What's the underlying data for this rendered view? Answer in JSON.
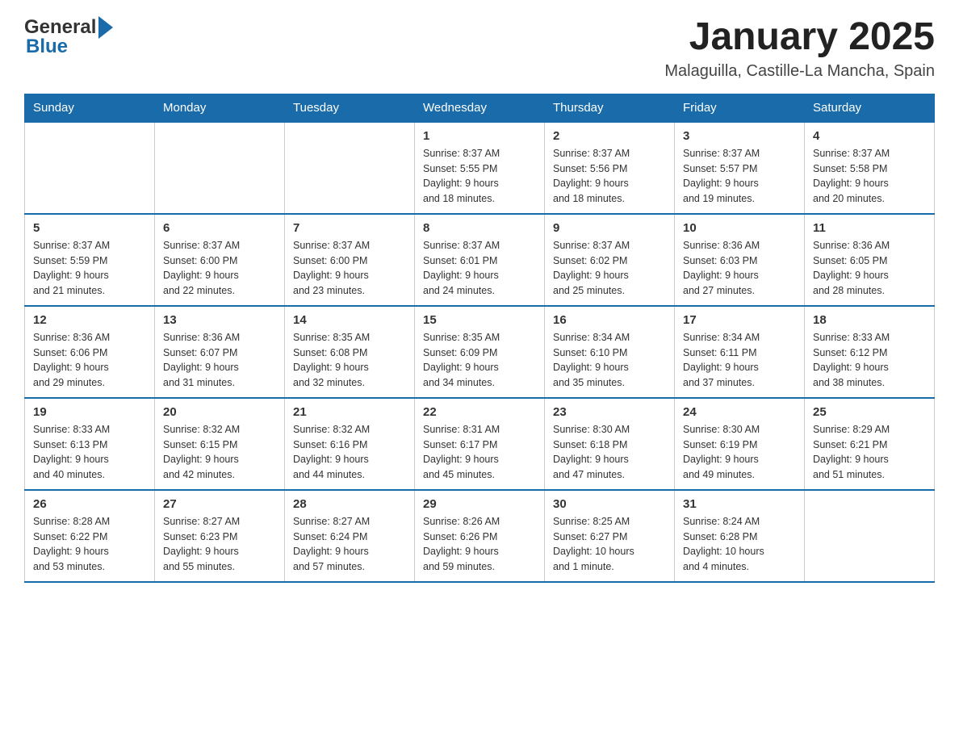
{
  "header": {
    "month_year": "January 2025",
    "location": "Malaguilla, Castille-La Mancha, Spain",
    "logo_general": "General",
    "logo_blue": "Blue"
  },
  "weekdays": [
    "Sunday",
    "Monday",
    "Tuesday",
    "Wednesday",
    "Thursday",
    "Friday",
    "Saturday"
  ],
  "weeks": [
    [
      {
        "day": "",
        "info": ""
      },
      {
        "day": "",
        "info": ""
      },
      {
        "day": "",
        "info": ""
      },
      {
        "day": "1",
        "info": "Sunrise: 8:37 AM\nSunset: 5:55 PM\nDaylight: 9 hours\nand 18 minutes."
      },
      {
        "day": "2",
        "info": "Sunrise: 8:37 AM\nSunset: 5:56 PM\nDaylight: 9 hours\nand 18 minutes."
      },
      {
        "day": "3",
        "info": "Sunrise: 8:37 AM\nSunset: 5:57 PM\nDaylight: 9 hours\nand 19 minutes."
      },
      {
        "day": "4",
        "info": "Sunrise: 8:37 AM\nSunset: 5:58 PM\nDaylight: 9 hours\nand 20 minutes."
      }
    ],
    [
      {
        "day": "5",
        "info": "Sunrise: 8:37 AM\nSunset: 5:59 PM\nDaylight: 9 hours\nand 21 minutes."
      },
      {
        "day": "6",
        "info": "Sunrise: 8:37 AM\nSunset: 6:00 PM\nDaylight: 9 hours\nand 22 minutes."
      },
      {
        "day": "7",
        "info": "Sunrise: 8:37 AM\nSunset: 6:00 PM\nDaylight: 9 hours\nand 23 minutes."
      },
      {
        "day": "8",
        "info": "Sunrise: 8:37 AM\nSunset: 6:01 PM\nDaylight: 9 hours\nand 24 minutes."
      },
      {
        "day": "9",
        "info": "Sunrise: 8:37 AM\nSunset: 6:02 PM\nDaylight: 9 hours\nand 25 minutes."
      },
      {
        "day": "10",
        "info": "Sunrise: 8:36 AM\nSunset: 6:03 PM\nDaylight: 9 hours\nand 27 minutes."
      },
      {
        "day": "11",
        "info": "Sunrise: 8:36 AM\nSunset: 6:05 PM\nDaylight: 9 hours\nand 28 minutes."
      }
    ],
    [
      {
        "day": "12",
        "info": "Sunrise: 8:36 AM\nSunset: 6:06 PM\nDaylight: 9 hours\nand 29 minutes."
      },
      {
        "day": "13",
        "info": "Sunrise: 8:36 AM\nSunset: 6:07 PM\nDaylight: 9 hours\nand 31 minutes."
      },
      {
        "day": "14",
        "info": "Sunrise: 8:35 AM\nSunset: 6:08 PM\nDaylight: 9 hours\nand 32 minutes."
      },
      {
        "day": "15",
        "info": "Sunrise: 8:35 AM\nSunset: 6:09 PM\nDaylight: 9 hours\nand 34 minutes."
      },
      {
        "day": "16",
        "info": "Sunrise: 8:34 AM\nSunset: 6:10 PM\nDaylight: 9 hours\nand 35 minutes."
      },
      {
        "day": "17",
        "info": "Sunrise: 8:34 AM\nSunset: 6:11 PM\nDaylight: 9 hours\nand 37 minutes."
      },
      {
        "day": "18",
        "info": "Sunrise: 8:33 AM\nSunset: 6:12 PM\nDaylight: 9 hours\nand 38 minutes."
      }
    ],
    [
      {
        "day": "19",
        "info": "Sunrise: 8:33 AM\nSunset: 6:13 PM\nDaylight: 9 hours\nand 40 minutes."
      },
      {
        "day": "20",
        "info": "Sunrise: 8:32 AM\nSunset: 6:15 PM\nDaylight: 9 hours\nand 42 minutes."
      },
      {
        "day": "21",
        "info": "Sunrise: 8:32 AM\nSunset: 6:16 PM\nDaylight: 9 hours\nand 44 minutes."
      },
      {
        "day": "22",
        "info": "Sunrise: 8:31 AM\nSunset: 6:17 PM\nDaylight: 9 hours\nand 45 minutes."
      },
      {
        "day": "23",
        "info": "Sunrise: 8:30 AM\nSunset: 6:18 PM\nDaylight: 9 hours\nand 47 minutes."
      },
      {
        "day": "24",
        "info": "Sunrise: 8:30 AM\nSunset: 6:19 PM\nDaylight: 9 hours\nand 49 minutes."
      },
      {
        "day": "25",
        "info": "Sunrise: 8:29 AM\nSunset: 6:21 PM\nDaylight: 9 hours\nand 51 minutes."
      }
    ],
    [
      {
        "day": "26",
        "info": "Sunrise: 8:28 AM\nSunset: 6:22 PM\nDaylight: 9 hours\nand 53 minutes."
      },
      {
        "day": "27",
        "info": "Sunrise: 8:27 AM\nSunset: 6:23 PM\nDaylight: 9 hours\nand 55 minutes."
      },
      {
        "day": "28",
        "info": "Sunrise: 8:27 AM\nSunset: 6:24 PM\nDaylight: 9 hours\nand 57 minutes."
      },
      {
        "day": "29",
        "info": "Sunrise: 8:26 AM\nSunset: 6:26 PM\nDaylight: 9 hours\nand 59 minutes."
      },
      {
        "day": "30",
        "info": "Sunrise: 8:25 AM\nSunset: 6:27 PM\nDaylight: 10 hours\nand 1 minute."
      },
      {
        "day": "31",
        "info": "Sunrise: 8:24 AM\nSunset: 6:28 PM\nDaylight: 10 hours\nand 4 minutes."
      },
      {
        "day": "",
        "info": ""
      }
    ]
  ]
}
